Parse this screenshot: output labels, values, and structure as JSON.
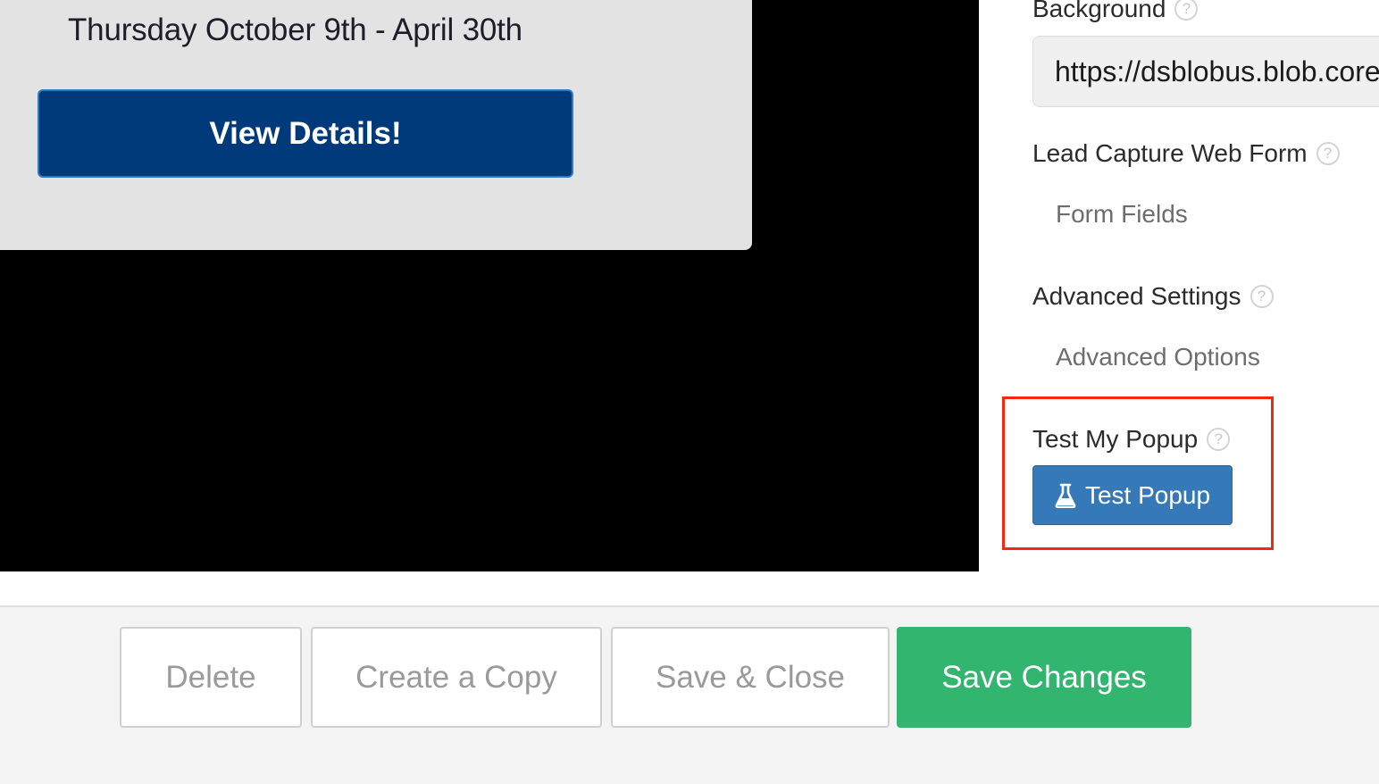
{
  "preview": {
    "date_text": "Thursday October 9th - April 30th",
    "view_details_label": "View Details!"
  },
  "settings": {
    "background_label": "Background",
    "background_url": "https://dsblobus.blob.core",
    "lead_capture_label": "Lead Capture Web Form",
    "form_fields_link": "Form Fields",
    "advanced_settings_label": "Advanced Settings",
    "advanced_options_link": "Advanced Options",
    "test_my_popup_label": "Test My Popup",
    "test_popup_button": "Test Popup",
    "help_glyph": "?"
  },
  "footer": {
    "delete_label": "Delete",
    "copy_label": "Create a Copy",
    "save_close_label": "Save & Close",
    "save_changes_label": "Save Changes"
  },
  "colors": {
    "view_button": "#003a7a",
    "test_button": "#3579b8",
    "save_changes": "#32b56e",
    "highlight": "#f2290e"
  },
  "icons": {
    "help": "help-circle-icon",
    "test": "flask-icon"
  }
}
